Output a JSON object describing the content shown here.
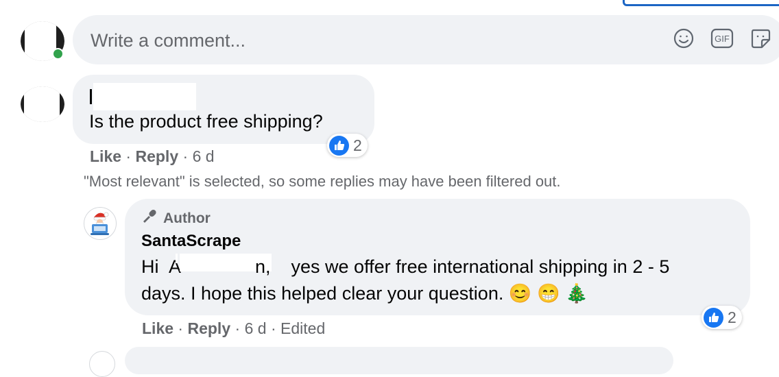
{
  "composer": {
    "placeholder": "Write a comment...",
    "tools": [
      "emoji-icon",
      "gif-icon",
      "sticker-icon"
    ],
    "gif_label": "GIF"
  },
  "comment": {
    "text": "Is the product free shipping?",
    "reaction_count": "2",
    "like_label": "Like",
    "reply_label": "Reply",
    "time": "6 d"
  },
  "filter_note": "\"Most relevant\" is selected, so some replies may have been filtered out.",
  "reply": {
    "badge": "Author",
    "author": "SantaScrape",
    "line1_start": "Hi",
    "line1_mid": "A",
    "line1_mid2": "n,",
    "line1_end": " yes we offer free international shipping in 2 - 5",
    "line2": "days. I hope this helped clear your question.",
    "emojis": [
      "😊",
      "😁",
      "🎄"
    ],
    "reaction_count": "2",
    "like_label": "Like",
    "reply_label": "Reply",
    "time": "6 d",
    "edited": "Edited"
  },
  "colors": {
    "bubble": "#f0f2f5",
    "like_blue": "#1877f2",
    "online": "#31a24c",
    "muted": "#65676b"
  }
}
